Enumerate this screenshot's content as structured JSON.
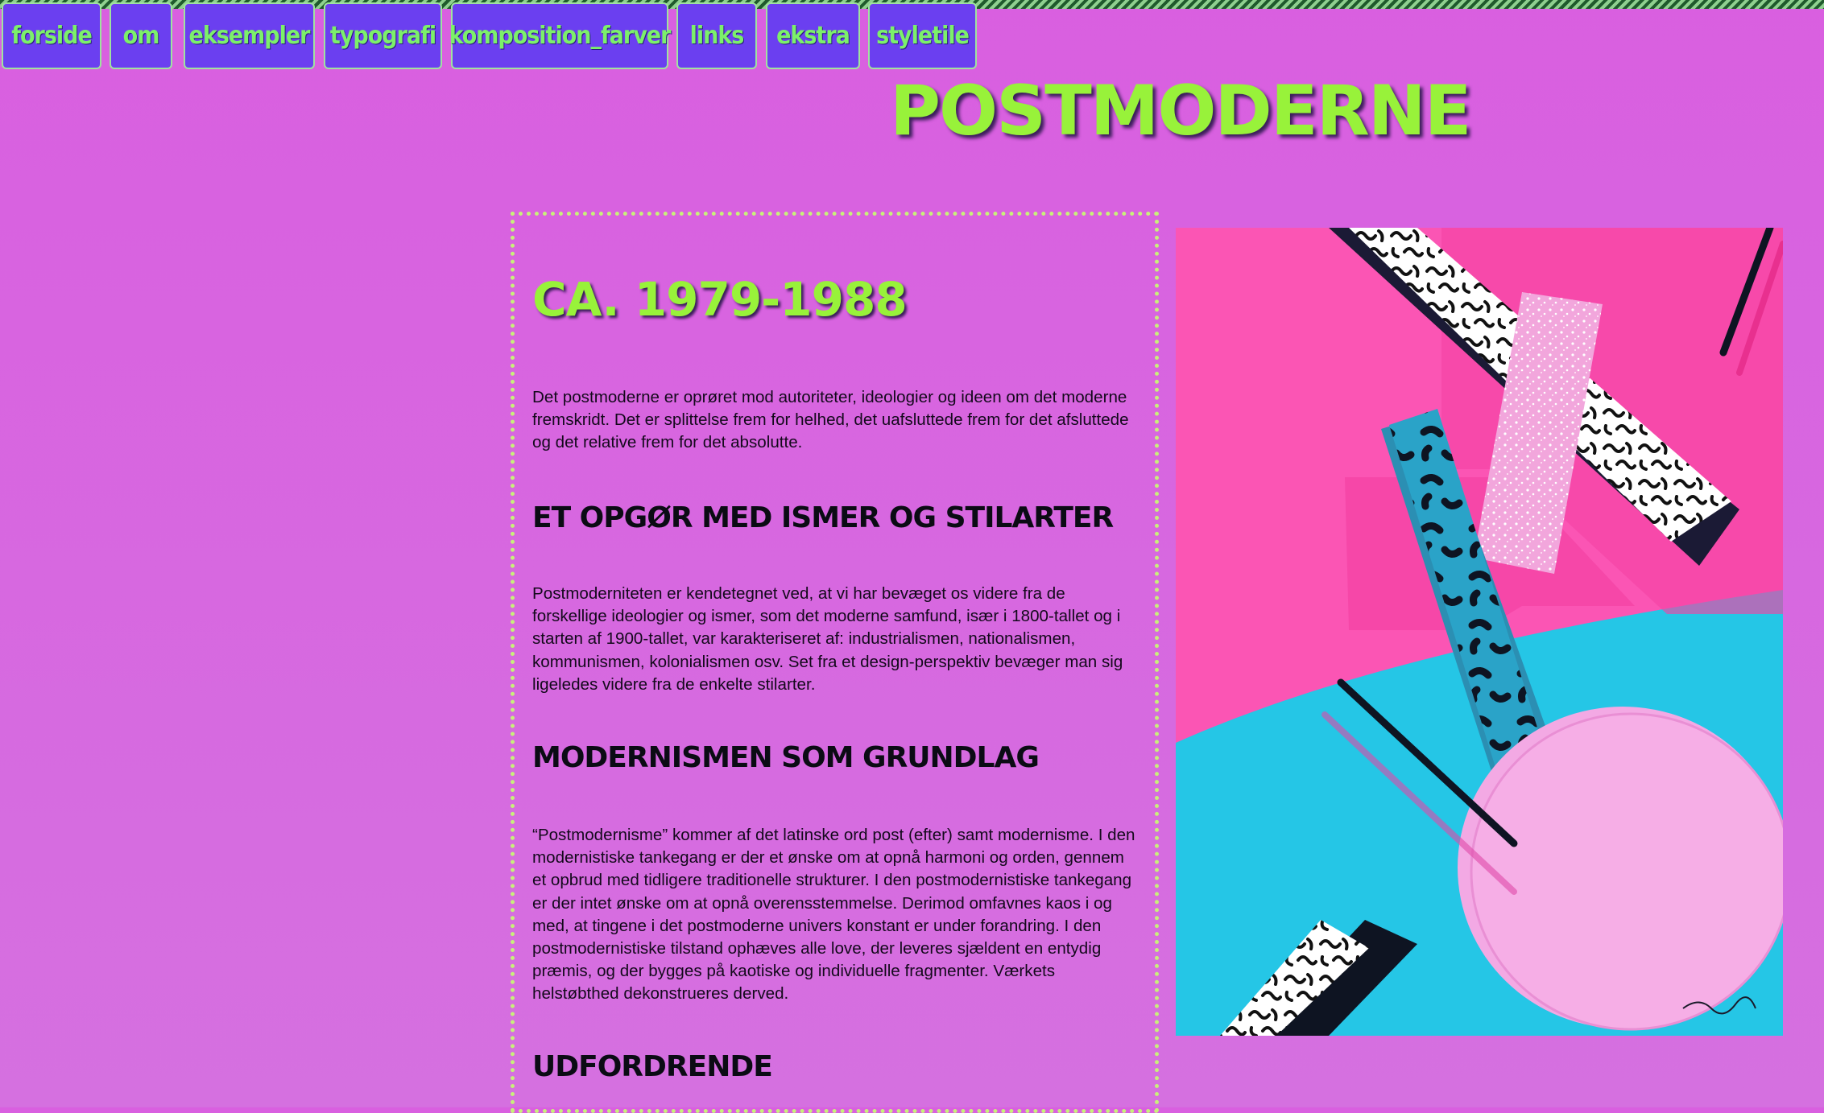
{
  "nav": {
    "items": [
      {
        "label": "forside"
      },
      {
        "label": "om"
      },
      {
        "label": "eksempler"
      },
      {
        "label": "typografi"
      },
      {
        "label": "komposition_farver"
      },
      {
        "label": "links"
      },
      {
        "label": "ekstra"
      },
      {
        "label": "styletile"
      }
    ]
  },
  "page": {
    "title": "Postmoderne"
  },
  "content": {
    "period": "Ca. 1979-1988",
    "intro": "Det postmoderne er oprøret mod autoriteter, ideologier og ideen om det moderne fremskridt. Det er splittelse frem for helhed, det uafsluttede frem for det afsluttede og det relative frem for det absolutte.",
    "sections": [
      {
        "heading": "Et opgør med ismer og stilarter",
        "text": "Postmoderniteten er kendetegnet ved, at vi har bevæget os videre fra de forskellige ideologier og ismer, som det moderne samfund, især i 1800-tallet og i starten af 1900-tallet, var karakteriseret af: industrialismen, nationalismen, kommunismen, kolonialismen osv. Set fra et design-perspektiv bevæger man sig ligeledes videre fra de enkelte stilarter."
      },
      {
        "heading": "Modernismen som grundlag",
        "text": "“Postmodernisme” kommer af det latinske ord post (efter) samt modernisme. I den modernistiske tankegang er der et ønske om at opnå harmoni og orden, gennem et opbrud med tidligere traditionelle strukturer. I den postmodernistiske tankegang er der intet ønske om at opnå overensstemmelse. Derimod omfavnes kaos i og med, at tingene i det postmoderne univers konstant er under forandring. I den postmodernistiske tilstand ophæves alle love, der leveres sjældent en entydig præmis, og der bygges på kaotiske og individuelle frag­menter. Værkets helstøbthed dekonstrueres derved."
      },
      {
        "heading": "Udfordrende"
      }
    ]
  },
  "colors": {
    "background": "#d95fe0",
    "nav_button": "#6b3ff0",
    "nav_text": "#7cf06a",
    "title_green": "#98f23a",
    "poster_pink": "#fb55b4",
    "poster_cyan": "#25c6e6"
  },
  "poster": {
    "name": "memphis-pattern-poster"
  }
}
